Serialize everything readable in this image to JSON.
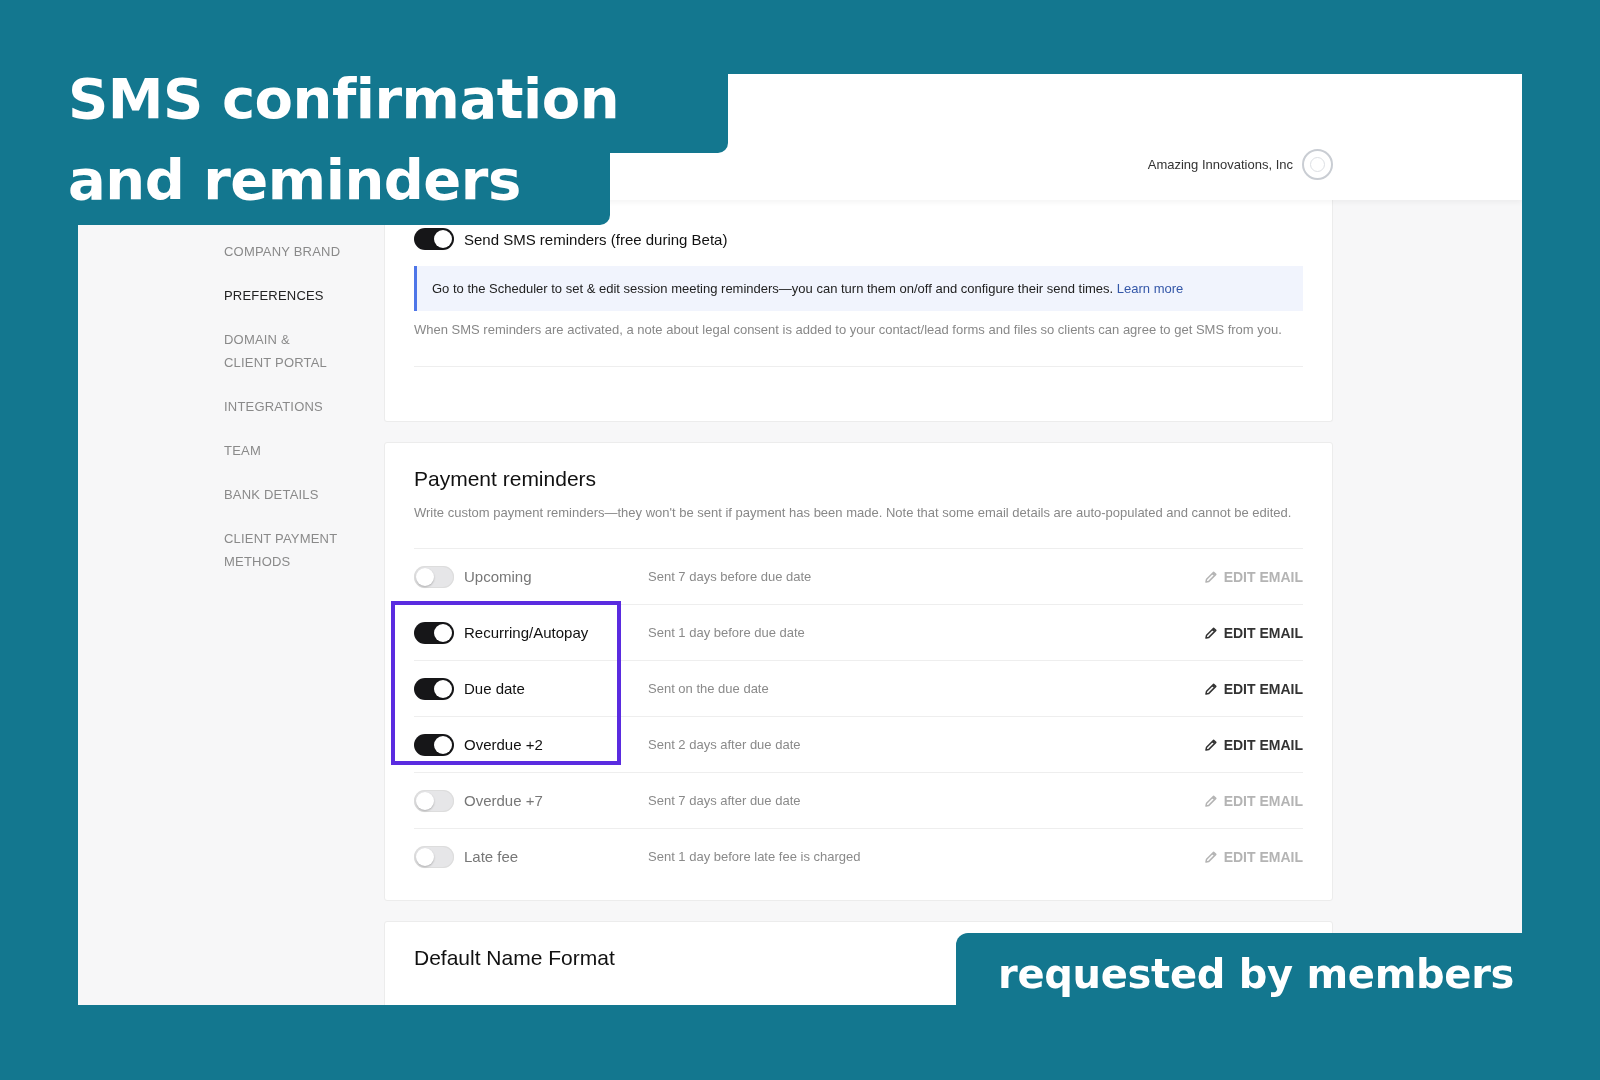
{
  "headline": {
    "lines": [
      "SMS confirmation",
      "and reminders"
    ]
  },
  "header": {
    "company": "Amazing Innovations, Inc"
  },
  "sidebar": {
    "items": [
      {
        "label": "COMPANY BRAND",
        "selected": false
      },
      {
        "label": "PREFERENCES",
        "selected": true
      },
      {
        "label": "DOMAIN &\nCLIENT PORTAL",
        "selected": false
      },
      {
        "label": "INTEGRATIONS",
        "selected": false
      },
      {
        "label": "TEAM",
        "selected": false
      },
      {
        "label": "BANK DETAILS",
        "selected": false
      },
      {
        "label": "CLIENT PAYMENT\nMETHODS",
        "selected": false
      }
    ]
  },
  "sms_card": {
    "toggle": {
      "label": "Send SMS reminders (free during Beta)",
      "on": true
    },
    "info": {
      "text": "Go to the Scheduler to set & edit session meeting reminders—you can turn them on/off and configure their send times.",
      "link": "Learn more"
    },
    "note": "When SMS reminders are activated, a note about legal consent is added to your contact/lead forms and files so clients can agree to get SMS from you."
  },
  "payment_reminders": {
    "title": "Payment reminders",
    "description": "Write custom payment reminders—they won't be sent if payment has been made. Note that some email details are auto-populated and cannot be edited.",
    "rows": [
      {
        "name": "Upcoming",
        "on": false,
        "schedule": "Sent 7 days before due date",
        "action": "EDIT EMAIL",
        "highlighted": false
      },
      {
        "name": "Recurring/Autopay",
        "on": true,
        "schedule": "Sent 1 day before due date",
        "action": "EDIT EMAIL",
        "highlighted": true
      },
      {
        "name": "Due date",
        "on": true,
        "schedule": "Sent on the due date",
        "action": "EDIT EMAIL",
        "highlighted": true
      },
      {
        "name": "Overdue +2",
        "on": true,
        "schedule": "Sent 2 days after due date",
        "action": "EDIT EMAIL",
        "highlighted": true
      },
      {
        "name": "Overdue +7",
        "on": false,
        "schedule": "Sent 7 days after due date",
        "action": "EDIT EMAIL",
        "highlighted": false
      },
      {
        "name": "Late fee",
        "on": false,
        "schedule": "Sent 1 day before late fee is charged",
        "action": "EDIT EMAIL",
        "highlighted": false
      }
    ]
  },
  "name_format": {
    "title": "Default Name Format"
  },
  "tagline": "requested by members"
}
